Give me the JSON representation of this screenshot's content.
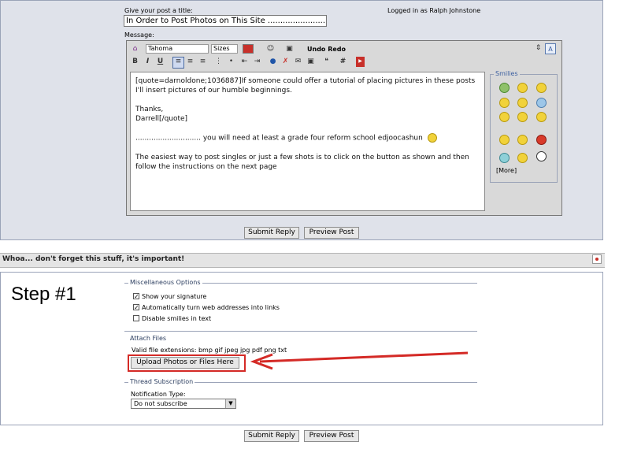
{
  "post": {
    "title_label": "Give your post a title:",
    "title_value": "In Order to Post Photos on This Site  .........................",
    "logged_in": "Logged in as Ralph Johnstone",
    "message_label": "Message:"
  },
  "toolbar": {
    "font": "Tahoma",
    "size": "Sizes",
    "undo_redo": "Undo Redo",
    "text_color": "#c8302a"
  },
  "message": {
    "line1": "[quote=darnoldone;1036887]If someone could offer a tutorial of placing pictures in these posts",
    "line2": "I'll insert pictures of our humble beginnings.",
    "line3": "Thanks,",
    "line4": "Darrell[/quote]",
    "line5": ".............................  you will need at least a grade four reform school edjoocashun",
    "line6": "The easiest way to post singles or just a few shots is to click on the button as shown and then",
    "line7": "follow the instructions on the next page"
  },
  "smilies": {
    "legend": "Smilies",
    "more": "[More]"
  },
  "buttons": {
    "submit": "Submit Reply",
    "preview": "Preview Post"
  },
  "options_bar": {
    "title": "Whoa... don't forget this stuff, it's important!"
  },
  "step_label": "Step #1",
  "misc": {
    "legend": "Miscellaneous Options",
    "opt1": "Show your signature",
    "opt2": "Automatically turn web addresses into links",
    "opt3": "Disable smilies in text"
  },
  "attach": {
    "legend": "Attach Files",
    "extensions": "Valid file extensions: bmp gif jpeg jpg pdf png txt",
    "upload_button": "Upload Photos or Files Here"
  },
  "subscription": {
    "legend": "Thread Subscription",
    "notify_label": "Notification Type:",
    "notify_value": "Do not subscribe"
  },
  "colors": {
    "highlight_red": "#d42a26",
    "panel_bg": "#dfe2ea",
    "legend_blue": "#3b5fa0"
  }
}
